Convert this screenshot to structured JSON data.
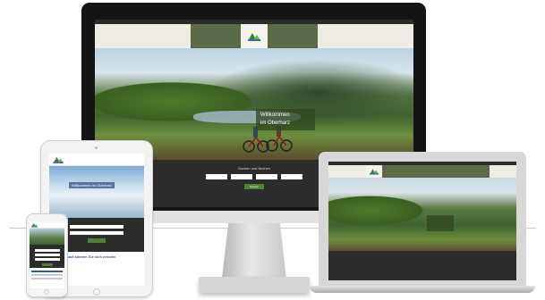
{
  "scene": {
    "description_devices": [
      "desktop-monitor",
      "laptop",
      "tablet",
      "phone"
    ]
  },
  "site": {
    "hero_title_line1": "Willkommen",
    "hero_title_line2": "im Oberharz",
    "booking_title": "Suchen und Buchen",
    "search_button": "Suchen"
  },
  "tablet": {
    "hero_title": "Willkommen im Oberharz",
    "booking_button": "Suchen",
    "heading": "Im Oberharz können Sie sich erholen"
  },
  "colors": {
    "brand_green": "#5b6a48",
    "button_green": "#4f7f3a",
    "booking_bg": "#2c2c2c",
    "logo_blue": "#2f6fb0"
  }
}
